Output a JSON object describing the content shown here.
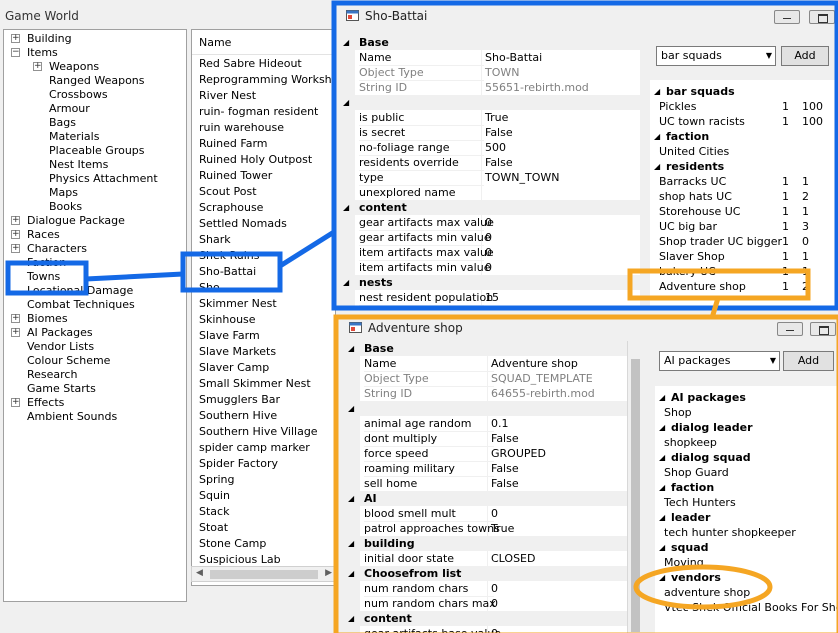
{
  "main": {
    "title": "Game World"
  },
  "tree": [
    {
      "label": "Building",
      "toggle": "+",
      "indent": 0
    },
    {
      "label": "Items",
      "toggle": "-",
      "indent": 0
    },
    {
      "label": "Weapons",
      "toggle": "+",
      "indent": 1
    },
    {
      "label": "Ranged Weapons",
      "toggle": "",
      "indent": 1
    },
    {
      "label": "Crossbows",
      "toggle": "",
      "indent": 1
    },
    {
      "label": "Armour",
      "toggle": "",
      "indent": 1
    },
    {
      "label": "Bags",
      "toggle": "",
      "indent": 1
    },
    {
      "label": "Materials",
      "toggle": "",
      "indent": 1
    },
    {
      "label": "Placeable Groups",
      "toggle": "",
      "indent": 1
    },
    {
      "label": "Nest Items",
      "toggle": "",
      "indent": 1
    },
    {
      "label": "Physics Attachment",
      "toggle": "",
      "indent": 1
    },
    {
      "label": "Maps",
      "toggle": "",
      "indent": 1
    },
    {
      "label": "Books",
      "toggle": "",
      "indent": 1
    },
    {
      "label": "Dialogue Package",
      "toggle": "+",
      "indent": 0
    },
    {
      "label": "Races",
      "toggle": "+",
      "indent": 0
    },
    {
      "label": "Characters",
      "toggle": "+",
      "indent": 0
    },
    {
      "label": "Faction",
      "toggle": "",
      "indent": 0
    },
    {
      "label": "Towns",
      "toggle": "",
      "indent": 0
    },
    {
      "label": "Locational Damage",
      "toggle": "",
      "indent": 0
    },
    {
      "label": "Combat Techniques",
      "toggle": "",
      "indent": 0
    },
    {
      "label": "Biomes",
      "toggle": "+",
      "indent": 0
    },
    {
      "label": "AI Packages",
      "toggle": "+",
      "indent": 0
    },
    {
      "label": "Vendor Lists",
      "toggle": "",
      "indent": 0
    },
    {
      "label": "Colour Scheme",
      "toggle": "",
      "indent": 0
    },
    {
      "label": "Research",
      "toggle": "",
      "indent": 0
    },
    {
      "label": "Game Starts",
      "toggle": "",
      "indent": 0
    },
    {
      "label": "Effects",
      "toggle": "+",
      "indent": 0
    },
    {
      "label": "Ambient Sounds",
      "toggle": "",
      "indent": 0
    }
  ],
  "list": {
    "header": "Name",
    "items": [
      "Red Sabre Hideout",
      "Reprogramming Workshop",
      "River Nest",
      "ruin- fogman resident",
      "ruin warehouse",
      "Ruined Farm",
      "Ruined Holy Outpost",
      "Ruined Tower",
      "Scout Post",
      "Scraphouse",
      "Settled Nomads",
      "Shark",
      "Shek Ruins",
      "Sho-Battai",
      "Sho",
      "Skimmer Nest",
      "Skinhouse",
      "Slave Farm",
      "Slave Markets",
      "Slaver Camp",
      "Small Skimmer Nest",
      "Smugglers Bar",
      "Southern Hive",
      "Southern Hive Village",
      "spider camp marker",
      "Spider Factory",
      "Spring",
      "Squin",
      "Stack",
      "Stoat",
      "Stone Camp",
      "Suspicious Lab"
    ]
  },
  "win1": {
    "title": "Sho-Battai",
    "props": [
      {
        "type": "cat",
        "label": "Base"
      },
      {
        "key": "Name",
        "val": "Sho-Battai"
      },
      {
        "key": "Object Type",
        "val": "TOWN",
        "gray": true
      },
      {
        "key": "String ID",
        "val": "55651-rebirth.mod",
        "gray": true
      },
      {
        "type": "cat",
        "label": ""
      },
      {
        "key": "is public",
        "val": "True"
      },
      {
        "key": "is secret",
        "val": "False"
      },
      {
        "key": "no-foliage range",
        "val": "500"
      },
      {
        "key": "residents override",
        "val": "False"
      },
      {
        "key": "type",
        "val": "TOWN_TOWN"
      },
      {
        "key": "unexplored name",
        "val": ""
      },
      {
        "type": "cat",
        "label": "content"
      },
      {
        "key": "gear artifacts max value",
        "val": "0"
      },
      {
        "key": "gear artifacts min value",
        "val": "0"
      },
      {
        "key": "item artifacts max value",
        "val": "0"
      },
      {
        "key": "item artifacts min value",
        "val": "0"
      },
      {
        "type": "cat",
        "label": "nests"
      },
      {
        "key": "nest resident population",
        "val": "15"
      }
    ],
    "combo": "bar squads",
    "add": "Add",
    "refs": [
      {
        "type": "cat",
        "label": "bar squads"
      },
      {
        "name": "Pickles",
        "a": "1",
        "b": "100"
      },
      {
        "name": "UC town racists",
        "a": "1",
        "b": "100"
      },
      {
        "type": "cat",
        "label": "faction"
      },
      {
        "name": "United Cities",
        "a": "",
        "b": ""
      },
      {
        "type": "cat",
        "label": "residents"
      },
      {
        "name": "Barracks UC",
        "a": "1",
        "b": "1"
      },
      {
        "name": "shop hats UC",
        "a": "1",
        "b": "2"
      },
      {
        "name": "Storehouse UC",
        "a": "1",
        "b": "1"
      },
      {
        "name": "UC big bar",
        "a": "1",
        "b": "3"
      },
      {
        "name": "Shop trader UC bigger",
        "a": "1",
        "b": "0"
      },
      {
        "name": "Slaver Shop",
        "a": "1",
        "b": "1"
      },
      {
        "name": "bakery UC",
        "a": "1",
        "b": "1"
      },
      {
        "name": "Adventure shop",
        "a": "1",
        "b": "2"
      }
    ]
  },
  "win2": {
    "title": "Adventure shop",
    "props": [
      {
        "type": "cat",
        "label": "Base"
      },
      {
        "key": "Name",
        "val": "Adventure shop"
      },
      {
        "key": "Object Type",
        "val": "SQUAD_TEMPLATE",
        "gray": true
      },
      {
        "key": "String ID",
        "val": "64655-rebirth.mod",
        "gray": true
      },
      {
        "type": "cat",
        "label": ""
      },
      {
        "key": "animal age random",
        "val": "0.1"
      },
      {
        "key": "dont multiply",
        "val": "False"
      },
      {
        "key": "force speed",
        "val": "GROUPED"
      },
      {
        "key": "roaming military",
        "val": "False"
      },
      {
        "key": "sell home",
        "val": "False"
      },
      {
        "type": "cat",
        "label": "AI"
      },
      {
        "key": "blood smell mult",
        "val": "0"
      },
      {
        "key": "patrol approaches towns",
        "val": "True"
      },
      {
        "type": "cat",
        "label": "building"
      },
      {
        "key": "initial door state",
        "val": "CLOSED"
      },
      {
        "type": "cat",
        "label": "Choosefrom list"
      },
      {
        "key": "num random chars",
        "val": "0"
      },
      {
        "key": "num random chars max",
        "val": "0"
      },
      {
        "type": "cat",
        "label": "content"
      },
      {
        "key": "gear artifacts base value",
        "val": "0"
      }
    ],
    "combo": "AI packages",
    "add": "Add",
    "refs": [
      {
        "type": "cat",
        "label": "AI packages"
      },
      {
        "name": "Shop"
      },
      {
        "type": "cat",
        "label": "dialog leader"
      },
      {
        "name": "shopkeep"
      },
      {
        "type": "cat",
        "label": "dialog squad"
      },
      {
        "name": "Shop Guard"
      },
      {
        "type": "cat",
        "label": "faction"
      },
      {
        "name": "Tech Hunters"
      },
      {
        "type": "cat",
        "label": "leader"
      },
      {
        "name": "tech hunter shopkeeper"
      },
      {
        "type": "cat",
        "label": "squad"
      },
      {
        "name": "Moving"
      },
      {
        "type": "cat",
        "label": "vendors"
      },
      {
        "name": "adventure shop"
      },
      {
        "name": "Vtec Shek Official Books For Shop"
      }
    ]
  },
  "colors": {
    "blue": "#1469e6",
    "orange": "#f5a623"
  }
}
